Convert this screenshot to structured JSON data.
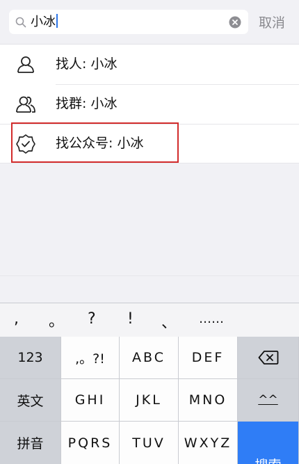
{
  "search": {
    "query": "小冰",
    "cancel_label": "取消"
  },
  "results": [
    {
      "label": "找人: 小冰",
      "icon": "person-icon"
    },
    {
      "label": "找群: 小冰",
      "icon": "group-icon"
    },
    {
      "label": "找公众号: 小冰",
      "icon": "official-account-icon"
    }
  ],
  "keyboard": {
    "punctuation": [
      ",",
      "。",
      "?",
      "!",
      "、",
      "……"
    ],
    "rows": [
      [
        "123",
        ",。?!",
        "ABC",
        "DEF",
        "⌫"
      ],
      [
        "英文",
        "GHI",
        "JKL",
        "MNO",
        "^^"
      ],
      [
        "拼音",
        "PQRS",
        "TUV",
        "WXYZ",
        "搜索"
      ]
    ]
  },
  "colors": {
    "highlight": "#d22b2b",
    "search_key": "#2f7df6",
    "caret": "#2b74e6"
  }
}
